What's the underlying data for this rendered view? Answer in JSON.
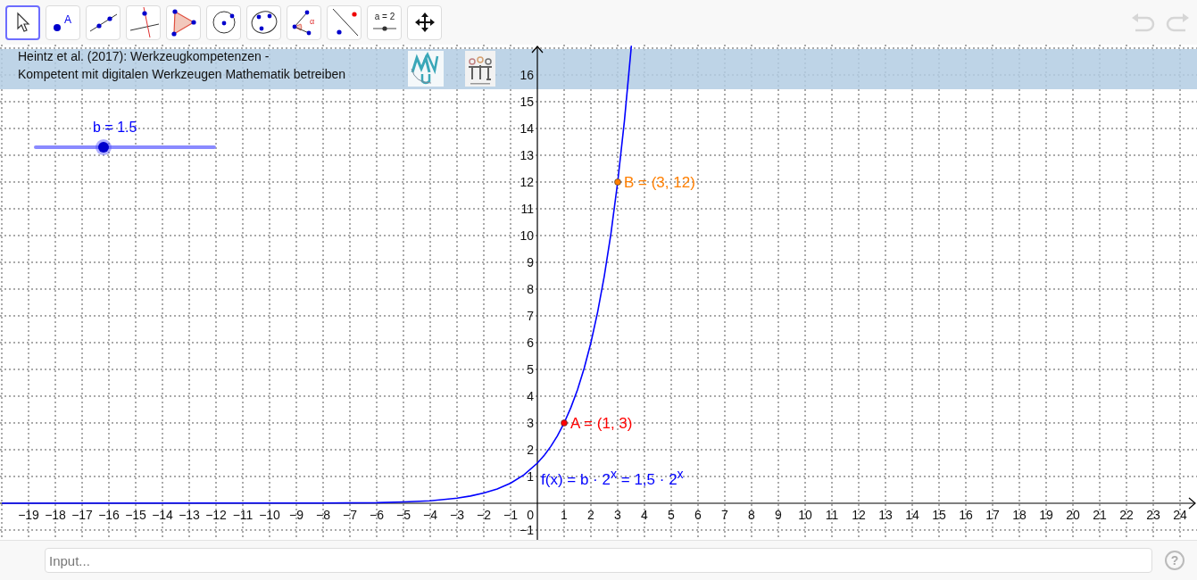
{
  "toolbar": {
    "tools": [
      {
        "kind": "move",
        "selected": true
      },
      {
        "kind": "point",
        "selected": false,
        "glyph": "A"
      },
      {
        "kind": "line",
        "selected": false
      },
      {
        "kind": "perpendicular",
        "selected": false
      },
      {
        "kind": "polygon",
        "selected": false
      },
      {
        "kind": "circle",
        "selected": false
      },
      {
        "kind": "conic",
        "selected": false
      },
      {
        "kind": "angle",
        "selected": false,
        "glyph": "α"
      },
      {
        "kind": "reflect",
        "selected": false
      },
      {
        "kind": "slider",
        "selected": false,
        "glyph": "a = 2"
      },
      {
        "kind": "move-view",
        "selected": false
      }
    ],
    "history": [
      {
        "kind": "undo",
        "disabled": true
      },
      {
        "kind": "redo",
        "disabled": true
      }
    ]
  },
  "graphics": {
    "banner": {
      "lines": [
        "Heintz et al. (2017): Werkzeugkompetenzen -",
        "Kompetent mit digitalen Werkzeugen Mathematik betreiben"
      ]
    },
    "slider": {
      "label": "b = 1.5",
      "level": 0.38
    },
    "chart_data": {
      "type": "line",
      "grid": true,
      "xlim": [
        -20.067,
        24.633
      ],
      "ylim": [
        -1.367,
        17.133
      ],
      "xticks": [
        {
          "value": -19,
          "label": "−19"
        },
        {
          "value": -18,
          "label": "−18"
        },
        {
          "value": -17,
          "label": "−17"
        },
        {
          "value": -16,
          "label": "−16"
        },
        {
          "value": -15,
          "label": "−15"
        },
        {
          "value": -14,
          "label": "−14"
        },
        {
          "value": -13,
          "label": "−13"
        },
        {
          "value": -12,
          "label": "−12"
        },
        {
          "value": -11,
          "label": "−11"
        },
        {
          "value": -10,
          "label": "−10"
        },
        {
          "value": -9,
          "label": "−9"
        },
        {
          "value": -8,
          "label": "−8"
        },
        {
          "value": -7,
          "label": "−7"
        },
        {
          "value": -6,
          "label": "−6"
        },
        {
          "value": -5,
          "label": "−5"
        },
        {
          "value": -4,
          "label": "−4"
        },
        {
          "value": -3,
          "label": "−3"
        },
        {
          "value": -2,
          "label": "−2"
        },
        {
          "value": -1,
          "label": "−1"
        },
        1,
        2,
        3,
        4,
        5,
        6,
        7,
        8,
        9,
        10,
        11,
        12,
        13,
        14,
        15,
        16,
        17,
        18,
        19,
        20,
        21,
        22,
        23,
        24
      ],
      "yticks": [
        {
          "value": -1,
          "label": "−1"
        },
        1,
        2,
        3,
        4,
        5,
        6,
        7,
        8,
        9,
        10,
        11,
        12,
        13,
        14,
        15,
        16
      ],
      "x": [
        -20,
        -8,
        -6,
        -5,
        -4,
        -3,
        -2.5,
        -2,
        -1.5,
        -1,
        -0.5,
        0,
        0.25,
        0.5,
        0.75,
        1,
        1.25,
        1.5,
        1.75,
        2,
        2.25,
        2.5,
        2.75,
        3,
        3.25,
        3.5,
        3.51
      ],
      "series": [
        {
          "name": "f(x) = b · 2$^{x}$ = 1,5 · 2$^{x}$",
          "color": "#0000ff",
          "values": [
            0,
            0.01,
            0.02,
            0.05,
            0.09,
            0.19,
            0.27,
            0.38,
            0.53,
            0.75,
            1.06,
            1.5,
            1.78,
            2.12,
            2.52,
            3,
            3.57,
            4.24,
            5.05,
            6,
            7.14,
            8.49,
            10.09,
            12,
            14.27,
            16.97,
            17.09
          ]
        }
      ],
      "annotations": [
        {
          "x": 1,
          "y": 3,
          "text": "A = (1, 3)"
        },
        {
          "x": 3,
          "y": 12,
          "text": "B = (3, 12)"
        }
      ]
    },
    "origin_label": "0",
    "points": [
      {
        "color": "#ff0000"
      },
      {
        "color": "#ff7f00"
      }
    ]
  },
  "input_bar": {
    "placeholder": "Input...",
    "help": "?"
  }
}
